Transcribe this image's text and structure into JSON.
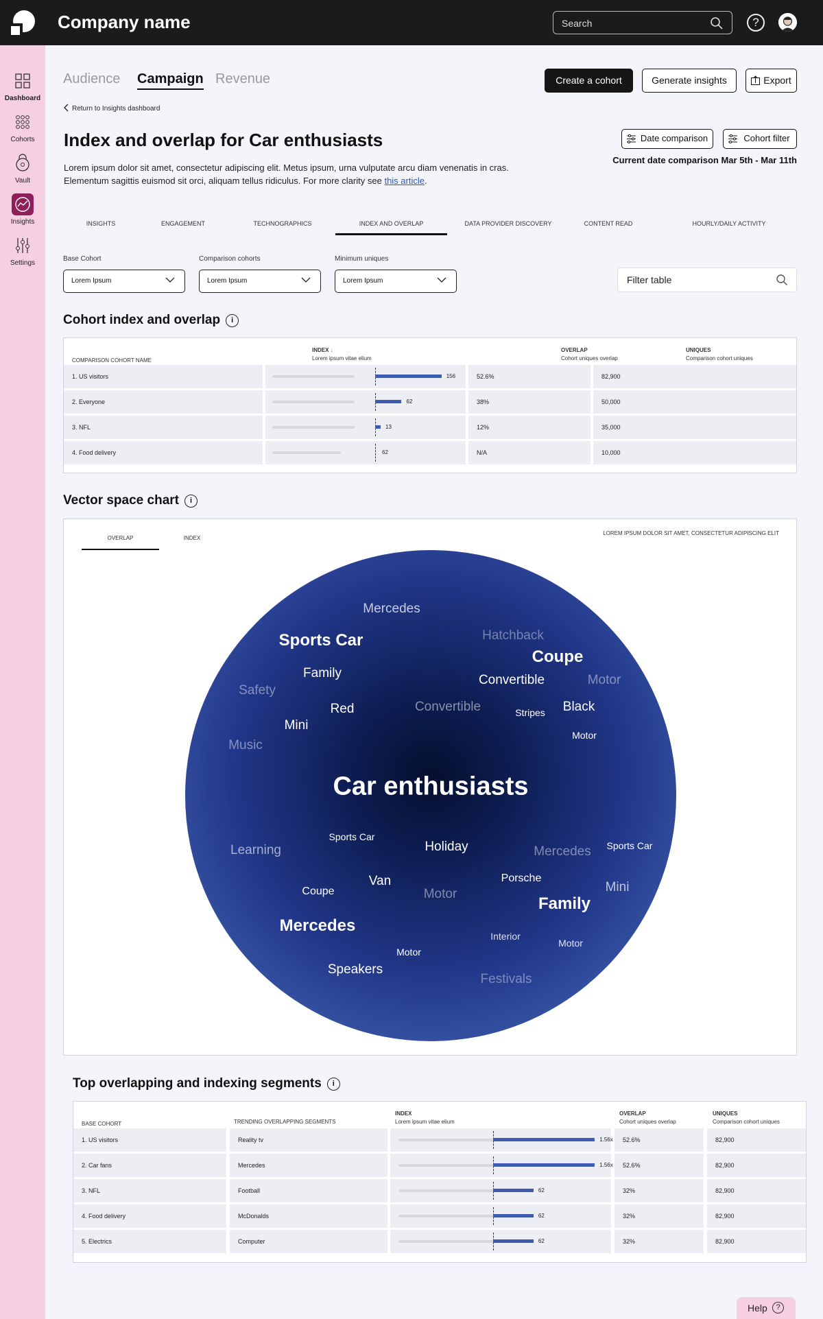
{
  "app": {
    "company": "Company name"
  },
  "search": {
    "label": "Search"
  },
  "sidebar": {
    "items": [
      {
        "label": "Dashboard",
        "icon": "dashboard-icon"
      },
      {
        "label": "Cohorts",
        "icon": "cohorts-icon"
      },
      {
        "label": "Vault",
        "icon": "vault-icon"
      },
      {
        "label": "Insights",
        "icon": "insights-icon",
        "active": true
      },
      {
        "label": "Settings",
        "icon": "settings-icon"
      }
    ]
  },
  "header": {
    "tabs": [
      "Audience",
      "Campaign",
      "Revenue"
    ],
    "active_tab": "Campaign",
    "create_cohort": "Create a cohort",
    "generate_insights": "Generate insights",
    "export": "Export",
    "back": "Return to Insights dashboard",
    "title": "Index and overlap for Car enthusiasts",
    "desc_pre": "Lorem ipsum dolor sit amet, consectetur adipiscing elit. Metus ipsum, urna vulputate arcu diam venenatis in cras. Elementum sagittis euismod sit orci, aliquam tellus ridiculus. For more clarity see ",
    "desc_link": "this article",
    "desc_post": ".",
    "date_comparison": "Date comparison",
    "cohort_filter": "Cohort filter",
    "current_date": "Current date comparison Mar 5th - Mar 11th"
  },
  "subtabs": [
    "INSIGHTS",
    "ENGAGEMENT",
    "TECHNOGRAPHICS",
    "INDEX AND OVERLAP",
    "DATA PROVIDER DISCOVERY",
    "CONTENT READ",
    "HOURLY/DAILY ACTIVITY"
  ],
  "filters": {
    "base_label": "Base Cohort",
    "base_value": "Lorem Ipsum",
    "comparison_label": "Comparison cohorts",
    "comparison_value": "Lorem Ipsum",
    "min_label": "Minimum uniques",
    "min_value": "Lorem Ipsum",
    "filter_placeholder": "Filter table"
  },
  "cohort_table": {
    "title": "Cohort index and overlap",
    "col_name": "COMPARISON COHORT NAME",
    "col_index": "INDEX",
    "col_index_sub": "Lorem ipsum vitae elium",
    "col_overlap": "OVERLAP",
    "col_overlap_sub": "Cohort uniques overlap",
    "col_uniques": "UNIQUES",
    "col_uniques_sub": "Comparison cohort uniques",
    "rows": [
      {
        "name": "1.  US visitors",
        "index": 156,
        "index_label": "156",
        "overlap": "52.6%",
        "uniques": "82,900"
      },
      {
        "name": "2.  Everyone",
        "index": 62,
        "index_label": "62",
        "overlap": "38%",
        "uniques": "50,000"
      },
      {
        "name": "3.  NFL",
        "index": 13,
        "index_label": "13",
        "overlap": "12%",
        "uniques": "35,000"
      },
      {
        "name": "4.  Food delivery",
        "index": 0,
        "index_label": "62",
        "overlap": "N/A",
        "uniques": "10,000"
      }
    ]
  },
  "vector": {
    "title": "Vector space chart",
    "tabs": [
      "OVERLAP",
      "INDEX"
    ],
    "note": "LOREM IPSUM DOLOR SIT AMET, CONSECTETUR ADIPISCING ELIT",
    "center": "Car enthusiasts",
    "words": [
      {
        "text": "Mercedes",
        "w": "n",
        "o": 0.75
      },
      {
        "text": "Hatchback",
        "w": "n",
        "o": 0.4
      },
      {
        "text": "Sports Car",
        "w": "b",
        "o": 1
      },
      {
        "text": "Coupe",
        "w": "b",
        "o": 1
      },
      {
        "text": "Family",
        "w": "n",
        "o": 1
      },
      {
        "text": "Convertible",
        "w": "n",
        "o": 1
      },
      {
        "text": "Motor",
        "w": "n",
        "o": 0.45
      },
      {
        "text": "Safety",
        "w": "n",
        "o": 0.45
      },
      {
        "text": "Red",
        "w": "n",
        "o": 1
      },
      {
        "text": "Convertible",
        "w": "n",
        "o": 0.5
      },
      {
        "text": "Stripes",
        "w": "n",
        "o": 1
      },
      {
        "text": "Black",
        "w": "n",
        "o": 1
      },
      {
        "text": "Mini",
        "w": "n",
        "o": 1
      },
      {
        "text": "Motor",
        "w": "n",
        "o": 1
      },
      {
        "text": "Music",
        "w": "n",
        "o": 0.45
      },
      {
        "text": "Sports Car",
        "w": "n",
        "o": 1
      },
      {
        "text": "Holiday",
        "w": "n",
        "o": 1
      },
      {
        "text": "Learning",
        "w": "n",
        "o": 0.6
      },
      {
        "text": "Mercedes",
        "w": "n",
        "o": 0.45
      },
      {
        "text": "Sports Car",
        "w": "n",
        "o": 1
      },
      {
        "text": "Van",
        "w": "n",
        "o": 1
      },
      {
        "text": "Porsche",
        "w": "n",
        "o": 1
      },
      {
        "text": "Mini",
        "w": "n",
        "o": 0.7
      },
      {
        "text": "Coupe",
        "w": "n",
        "o": 1
      },
      {
        "text": "Motor",
        "w": "n",
        "o": 0.45
      },
      {
        "text": "Family",
        "w": "b",
        "o": 1
      },
      {
        "text": "Mercedes",
        "w": "b",
        "o": 1
      },
      {
        "text": "Interior",
        "w": "n",
        "o": 0.85
      },
      {
        "text": "Motor",
        "w": "n",
        "o": 0.85
      },
      {
        "text": "Motor",
        "w": "n",
        "o": 1
      },
      {
        "text": "Speakers",
        "w": "n",
        "o": 1
      },
      {
        "text": "Festivals",
        "w": "n",
        "o": 0.4
      }
    ]
  },
  "segments": {
    "title": "Top overlapping and indexing segments",
    "col_base": "BASE COHORT",
    "col_trending": "TRENDING OVERLAPPING SEGMENTS",
    "col_index": "INDEX",
    "col_index_sub": "Lorem ipsum vitae elium",
    "col_overlap": "OVERLAP",
    "col_overlap_sub": "Cohort uniques overlap",
    "col_uniques": "UNIQUES",
    "col_uniques_sub": "Comparison cohort uniques",
    "rows": [
      {
        "base": "1.  US visitors",
        "segment": "Reality tv",
        "index": 1.56,
        "index_label": "1.56x",
        "overlap": "52.6%",
        "uniques": "82,900"
      },
      {
        "base": "2.  Car fans",
        "segment": "Mercedes",
        "index": 1.56,
        "index_label": "1.56x",
        "overlap": "52.6%",
        "uniques": "82,900"
      },
      {
        "base": "3.  NFL",
        "segment": "Football",
        "index": 0.62,
        "index_label": "62",
        "overlap": "32%",
        "uniques": "82,900"
      },
      {
        "base": "4.  Food delivery",
        "segment": "McDonalds",
        "index": 0.62,
        "index_label": "62",
        "overlap": "32%",
        "uniques": "82,900"
      },
      {
        "base": "5.  Electrics",
        "segment": "Computer",
        "index": 0.62,
        "index_label": "62",
        "overlap": "32%",
        "uniques": "82,900"
      }
    ]
  },
  "help": {
    "label": "Help"
  },
  "colors": {
    "accent": "#3d5bb1",
    "sidebar": "#f6cfe0",
    "active_nav": "#8e1f5b",
    "topbar": "#1b1b1b"
  }
}
